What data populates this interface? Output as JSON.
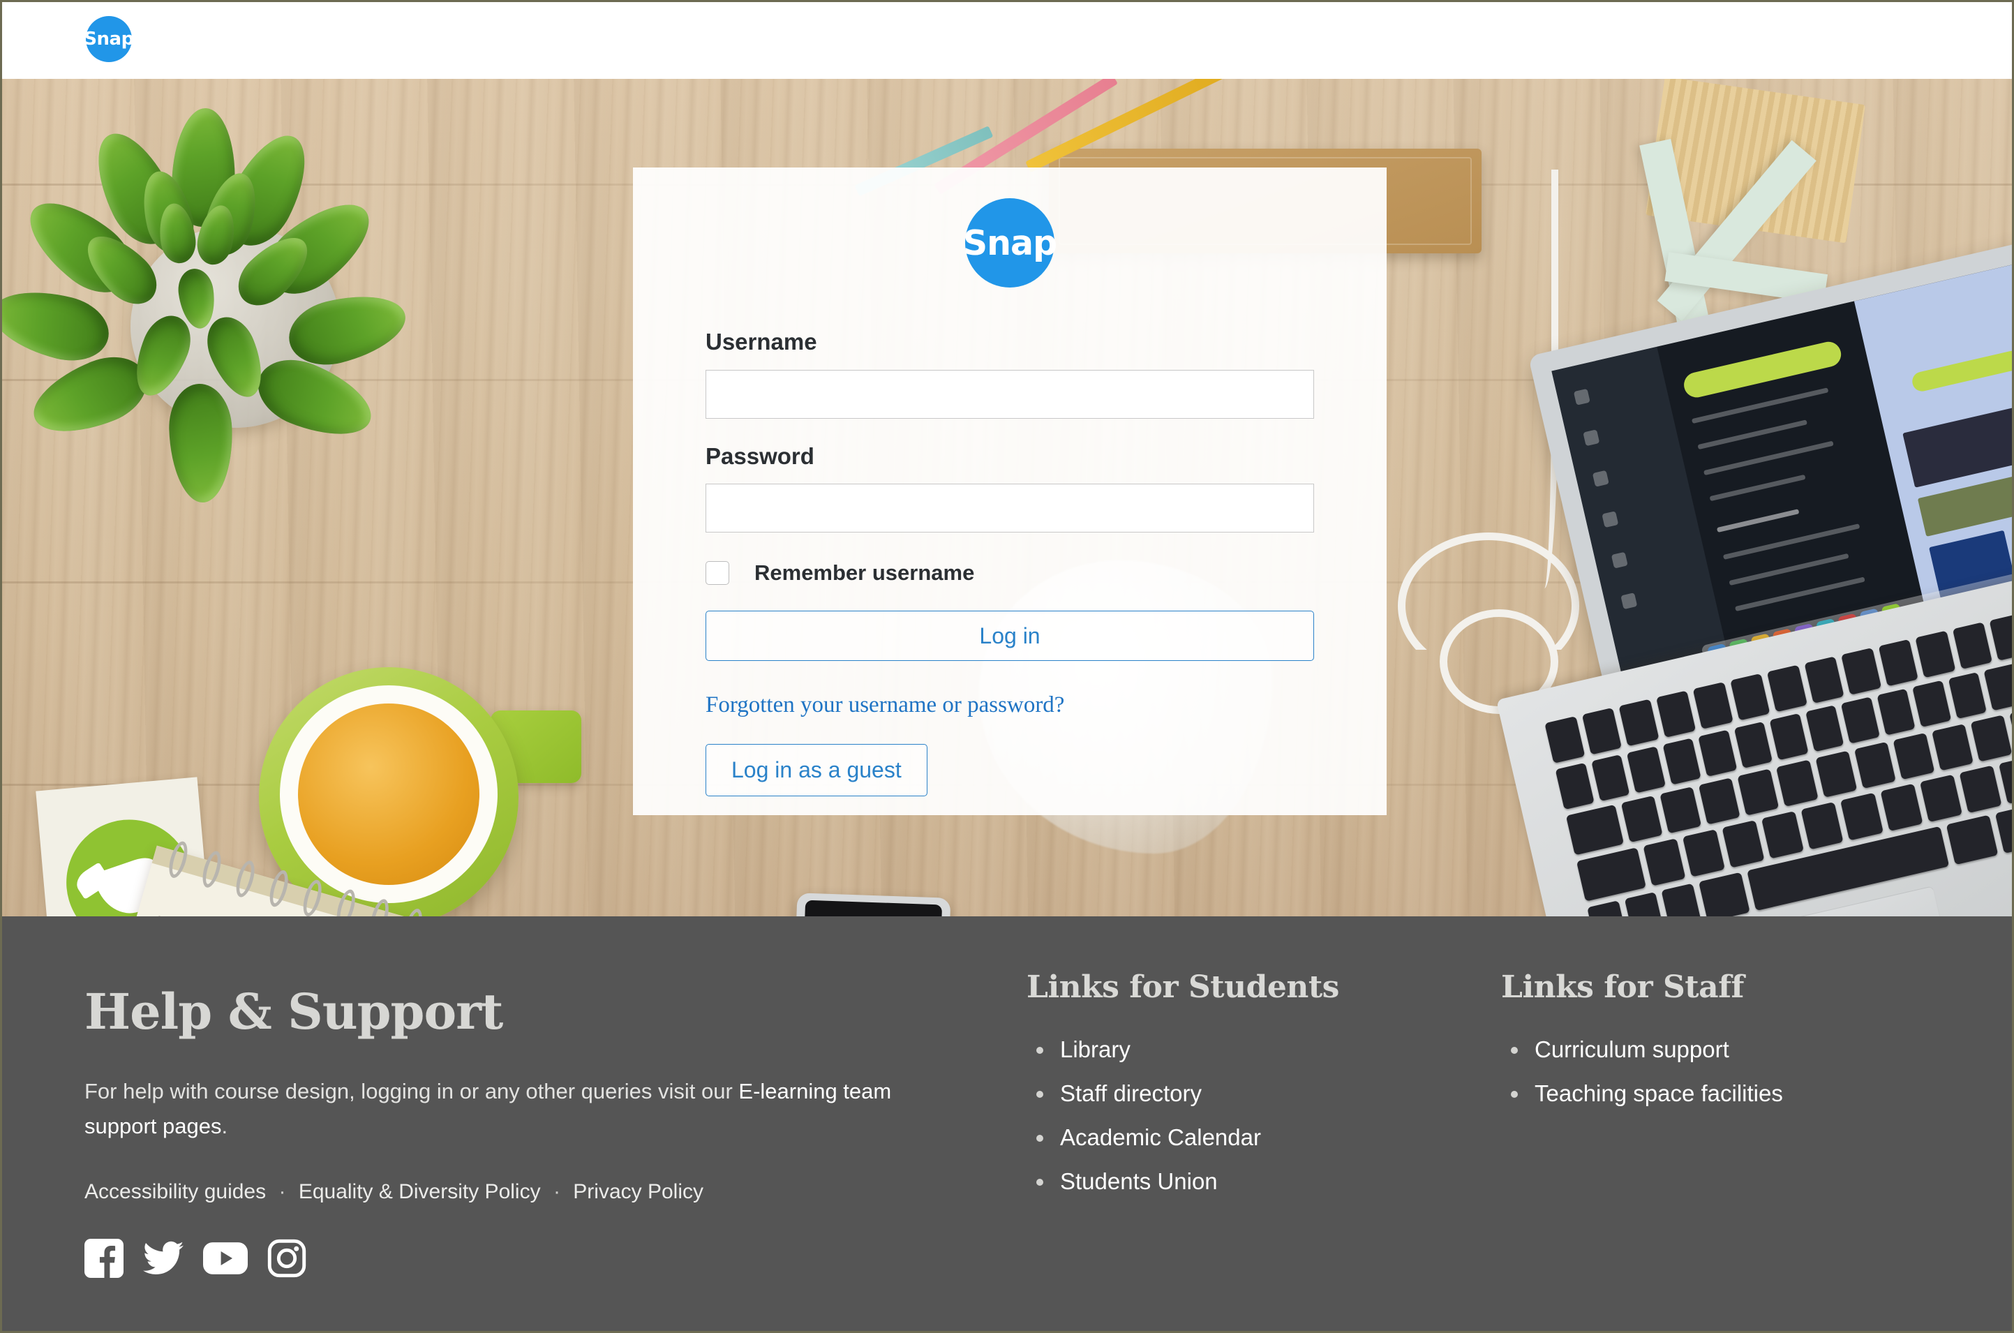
{
  "brand": {
    "name": "Snap",
    "accent_blue": "#2196e8",
    "link_blue": "#1f74c4",
    "footer_bg": "#555555"
  },
  "header": {
    "logo_text": "Snap",
    "logo_icon": "snap-logo-icon"
  },
  "login": {
    "logo_text": "Snap",
    "username_label": "Username",
    "username_value": "",
    "username_placeholder": "",
    "password_label": "Password",
    "password_value": "",
    "password_placeholder": "",
    "remember_label": "Remember username",
    "remember_checked": false,
    "login_button": "Log in",
    "forgot_link": "Forgotten your username or password?",
    "guest_button": "Log in as a guest"
  },
  "footer": {
    "help": {
      "heading": "Help & Support",
      "paragraph_before": "For help with course design, logging in or any other queries visit our ",
      "paragraph_link": "E-learning team support pages",
      "paragraph_after": ".",
      "policies": [
        "Accessibility guides",
        "Equality & Diversity Policy",
        "Privacy Policy"
      ],
      "policy_separator": "·",
      "social": [
        "facebook-icon",
        "twitter-icon",
        "youtube-icon",
        "instagram-icon"
      ]
    },
    "students": {
      "heading": "Links for Students",
      "items": [
        "Library",
        "Staff directory",
        "Academic Calendar",
        "Students Union"
      ]
    },
    "staff": {
      "heading": "Links for Staff",
      "items": [
        "Curriculum support",
        "Teaching space facilities"
      ]
    }
  },
  "background": {
    "description": "desk-photo",
    "objects": [
      "succulent-plant",
      "green-mug-of-tea",
      "green-logo-card",
      "spiral-notebook",
      "pencils",
      "brown-notepad",
      "wooden-letter-a",
      "macbook-air",
      "charging-cable",
      "smartphone-in-hand",
      "crumpled-paper"
    ]
  }
}
